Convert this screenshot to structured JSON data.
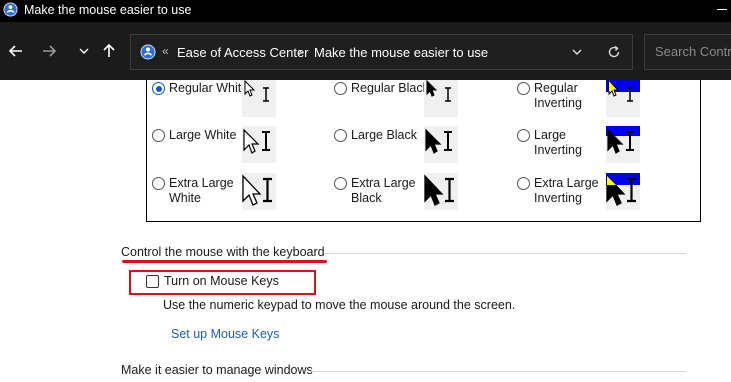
{
  "window": {
    "title": "Make the mouse easier to use"
  },
  "navbar": {
    "back_icon": "arrow-left-icon",
    "forward_icon": "arrow-right-icon",
    "up_icon": "arrow-up-icon",
    "address": {
      "root_separator": "«",
      "crumbs": [
        "Ease of Access Center",
        "Make the mouse easier to use"
      ],
      "separator": "›"
    },
    "search_placeholder": "Search Control Panel"
  },
  "pointer_schemes": {
    "options": [
      {
        "label": "Regular White",
        "selected": true,
        "pointer_color": "white",
        "size": "regular"
      },
      {
        "label": "Regular Black",
        "selected": false,
        "pointer_color": "black",
        "size": "regular"
      },
      {
        "label": "Regular Inverting",
        "selected": false,
        "pointer_color": "inverting",
        "size": "regular"
      },
      {
        "label": "Large White",
        "selected": false,
        "pointer_color": "white",
        "size": "large"
      },
      {
        "label": "Large Black",
        "selected": false,
        "pointer_color": "black",
        "size": "large"
      },
      {
        "label": "Large Inverting",
        "selected": false,
        "pointer_color": "inverting",
        "size": "large"
      },
      {
        "label": "Extra Large White",
        "selected": false,
        "pointer_color": "white",
        "size": "extra-large"
      },
      {
        "label": "Extra Large Black",
        "selected": false,
        "pointer_color": "black",
        "size": "extra-large"
      },
      {
        "label": "Extra Large Inverting",
        "selected": false,
        "pointer_color": "inverting",
        "size": "extra-large"
      }
    ]
  },
  "keyboard_section": {
    "title": "Control the mouse with the keyboard",
    "mouse_keys_label": "Turn on Mouse Keys",
    "mouse_keys_checked": false,
    "description": "Use the numeric keypad to move the mouse around the screen.",
    "setup_link": "Set up Mouse Keys"
  },
  "windows_section": {
    "title": "Make it easier to manage windows"
  },
  "colors": {
    "annotation_red": "#d4141a",
    "link_blue": "#1a5fb4",
    "title_bar": "#000000",
    "nav_bar": "#1b1b1b"
  }
}
